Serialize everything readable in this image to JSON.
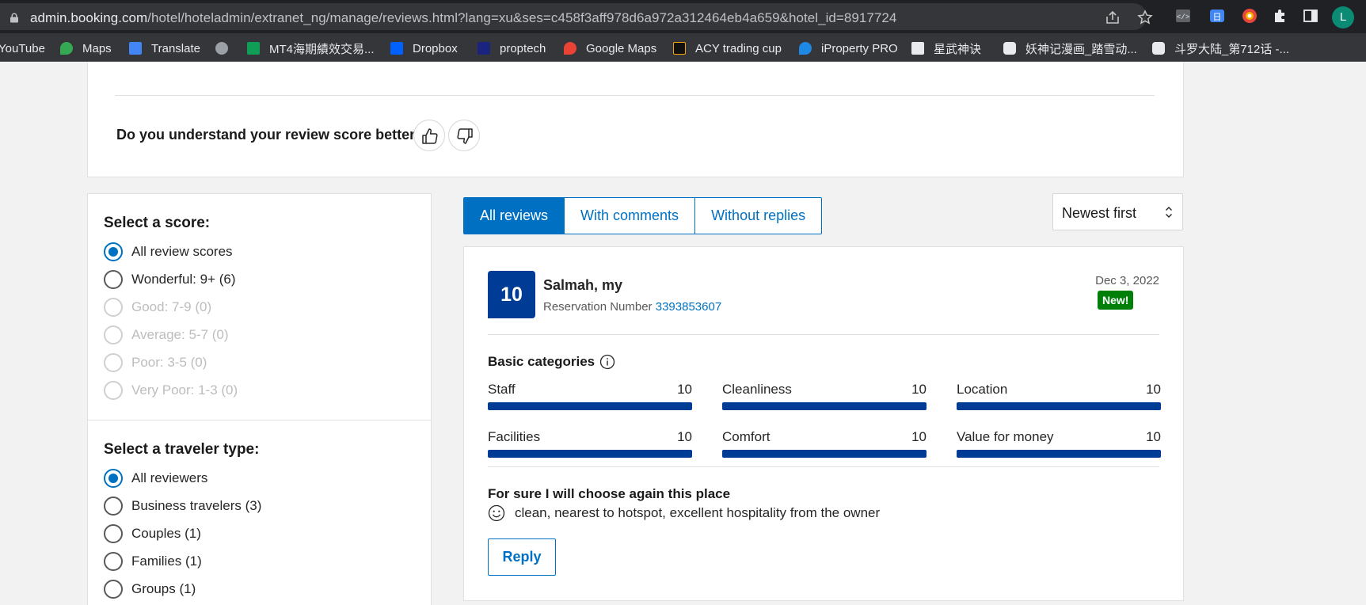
{
  "browser": {
    "url_host": "admin.booking.com",
    "url_path": "/hotel/hoteladmin/extranet_ng/manage/reviews.html?lang=xu&ses=c458f3aff978d6a972a312464eb4a659&hotel_id=8917724",
    "profile_initial": "L",
    "bookmarks": [
      {
        "label": "YouTube",
        "icon": "youtube-icon"
      },
      {
        "label": "Maps",
        "icon": "maps-icon"
      },
      {
        "label": "Translate",
        "icon": "translate-icon"
      },
      {
        "label": "",
        "icon": "globe-icon"
      },
      {
        "label": "MT4海期績效交易...",
        "icon": "sheets-icon"
      },
      {
        "label": "Dropbox",
        "icon": "dropbox-icon"
      },
      {
        "label": "proptech",
        "icon": "proptech-icon"
      },
      {
        "label": "Google Maps",
        "icon": "maps-icon"
      },
      {
        "label": "ACY trading cup",
        "icon": "acy-icon"
      },
      {
        "label": "iProperty PRO",
        "icon": "iproperty-icon"
      },
      {
        "label": "星武神诀",
        "icon": "doc-icon"
      },
      {
        "label": "妖神记漫画_踏雪动...",
        "icon": "manga-icon"
      },
      {
        "label": "斗罗大陆_第712话 -...",
        "icon": "manga-icon"
      }
    ]
  },
  "feedback": {
    "question": "Do you understand your review score better?"
  },
  "filters": {
    "score_title": "Select a score:",
    "scores": [
      {
        "label": "All review scores",
        "checked": true,
        "disabled": false
      },
      {
        "label": "Wonderful: 9+ (6)",
        "checked": false,
        "disabled": false
      },
      {
        "label": "Good: 7-9 (0)",
        "checked": false,
        "disabled": true
      },
      {
        "label": "Average: 5-7 (0)",
        "checked": false,
        "disabled": true
      },
      {
        "label": "Poor: 3-5 (0)",
        "checked": false,
        "disabled": true
      },
      {
        "label": "Very Poor: 1-3 (0)",
        "checked": false,
        "disabled": true
      }
    ],
    "traveler_title": "Select a traveler type:",
    "travelers": [
      {
        "label": "All reviewers",
        "checked": true
      },
      {
        "label": "Business travelers (3)",
        "checked": false
      },
      {
        "label": "Couples (1)",
        "checked": false
      },
      {
        "label": "Families (1)",
        "checked": false
      },
      {
        "label": "Groups (1)",
        "checked": false
      }
    ]
  },
  "tabs": [
    "All reviews",
    "With comments",
    "Without replies"
  ],
  "sort": {
    "label": "Newest first"
  },
  "review": {
    "score": "10",
    "reviewer": "Salmah, my",
    "reservation_label": "Reservation Number",
    "reservation_number": "3393853607",
    "date": "Dec 3, 2022",
    "badge": "New!",
    "categories_title": "Basic categories",
    "categories": [
      {
        "name": "Staff",
        "score": "10",
        "fill": 1.0
      },
      {
        "name": "Cleanliness",
        "score": "10",
        "fill": 1.0
      },
      {
        "name": "Location",
        "score": "10",
        "fill": 1.0
      },
      {
        "name": "Facilities",
        "score": "10",
        "fill": 1.0
      },
      {
        "name": "Comfort",
        "score": "10",
        "fill": 1.0
      },
      {
        "name": "Value for money",
        "score": "10",
        "fill": 1.0
      }
    ],
    "headline": "For sure I will choose again this place",
    "positive_text": "clean, nearest to hotspot, excellent hospitality from the owner",
    "reply_label": "Reply"
  },
  "colors": {
    "primary": "#0071c2",
    "score_bg": "#003b95",
    "badge_bg": "#008009"
  }
}
